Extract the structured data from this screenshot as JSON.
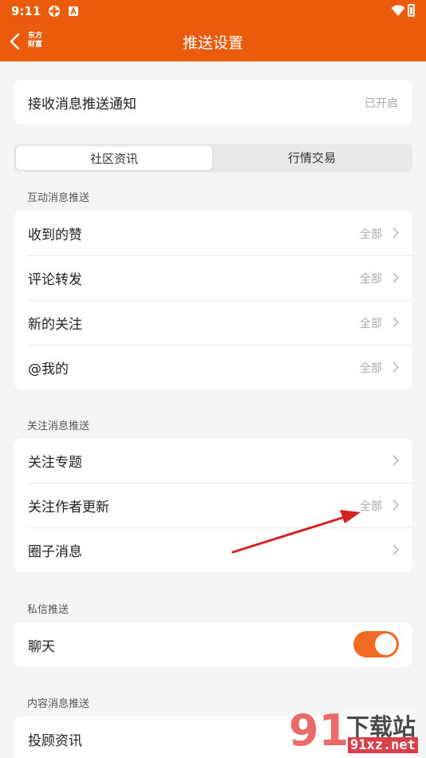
{
  "status_bar": {
    "time": "9:11"
  },
  "nav": {
    "title": "推送设置",
    "logo_line1": "东方",
    "logo_line2": "财富"
  },
  "receive_push": {
    "label": "接收消息推送通知",
    "value": "已开启"
  },
  "segment": {
    "tabs": [
      "社区资讯",
      "行情交易"
    ],
    "selected": "社区资讯"
  },
  "sections": {
    "interaction": {
      "title": "互动消息推送",
      "rows": [
        {
          "label": "收到的赞",
          "value": "全部"
        },
        {
          "label": "评论转发",
          "value": "全部"
        },
        {
          "label": "新的关注",
          "value": "全部"
        },
        {
          "label": "@我的",
          "value": "全部"
        }
      ]
    },
    "follow": {
      "title": "关注消息推送",
      "rows": [
        {
          "label": "关注专题",
          "value": ""
        },
        {
          "label": "关注作者更新",
          "value": "全部"
        },
        {
          "label": "圈子消息",
          "value": ""
        }
      ]
    },
    "private": {
      "title": "私信推送",
      "rows": [
        {
          "label": "聊天",
          "toggle": true
        }
      ]
    },
    "content": {
      "title": "内容消息推送",
      "rows": [
        {
          "label": "投顾资讯"
        }
      ]
    }
  },
  "watermark": {
    "number": "91",
    "text": "下载站",
    "url": "91xz.net"
  },
  "colors": {
    "brand": "#ea5b0c",
    "toggle_on": "#f06a22",
    "annotation_arrow": "#d62020"
  }
}
